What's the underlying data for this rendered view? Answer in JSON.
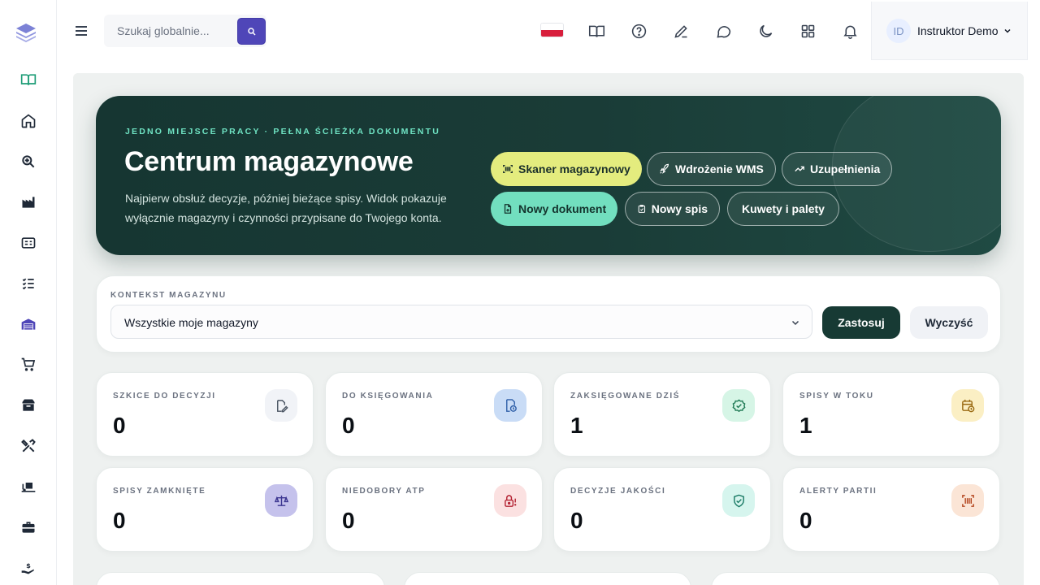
{
  "search": {
    "placeholder": "Szukaj globalnie..."
  },
  "user": {
    "initials": "ID",
    "name": "Instruktor Demo"
  },
  "hero": {
    "eyebrow": "JEDNO MIEJSCE PRACY · PEŁNA ŚCIEŻKA DOKUMENTU",
    "title": "Centrum magazynowe",
    "description": "Najpierw obsłuż decyzje, później bieżące spisy. Widok pokazuje wyłącznie magazyny i czynności przypisane do Twojego konta.",
    "buttons": [
      {
        "label": "Skaner magazynowy",
        "icon": "barcode-icon"
      },
      {
        "label": "Wdrożenie WMS",
        "icon": "rocket-icon"
      },
      {
        "label": "Uzupełnienia",
        "icon": "trend-icon"
      },
      {
        "label": "Nowy dokument",
        "icon": "file-plus-icon"
      },
      {
        "label": "Nowy spis",
        "icon": "clipboard-check-icon"
      },
      {
        "label": "Kuwety i palety",
        "icon": ""
      }
    ]
  },
  "context": {
    "label": "KONTEKST MAGAZYNU",
    "selected": "Wszystkie moje magazyny",
    "apply_label": "Zastosuj",
    "clear_label": "Wyczyść"
  },
  "stats": [
    {
      "label": "SZKICE DO DECYZJI",
      "value": "0",
      "icon": "file-edit-icon",
      "color": "#f1f3f7"
    },
    {
      "label": "DO KSIĘGOWANIA",
      "value": "0",
      "icon": "file-clock-icon",
      "color": "#c9dcf6"
    },
    {
      "label": "ZAKSIĘGOWANE DZIŚ",
      "value": "1",
      "icon": "badge-check-icon",
      "color": "#d6f5e6"
    },
    {
      "label": "SPISY W TOKU",
      "value": "1",
      "icon": "calendar-clock-icon",
      "color": "#fbefc4"
    },
    {
      "label": "SPISY ZAMKNIĘTE",
      "value": "0",
      "icon": "scale-icon",
      "color": "#c5c2ec"
    },
    {
      "label": "NIEDOBORY ATP",
      "value": "0",
      "icon": "lock-alert-icon",
      "color": "#fbe1e1"
    },
    {
      "label": "DECYZJE JAKOŚCI",
      "value": "0",
      "icon": "shield-check-icon",
      "color": "#d6f5ee"
    },
    {
      "label": "ALERTY PARTII",
      "value": "0",
      "icon": "scan-barcode-icon",
      "color": "#fbe5d6"
    }
  ],
  "colors": {
    "brand": "#4f46b8",
    "hero_bg": "#173a34",
    "accent_teal": "#72dfbf",
    "accent_yellow": "#e4ec7e"
  }
}
